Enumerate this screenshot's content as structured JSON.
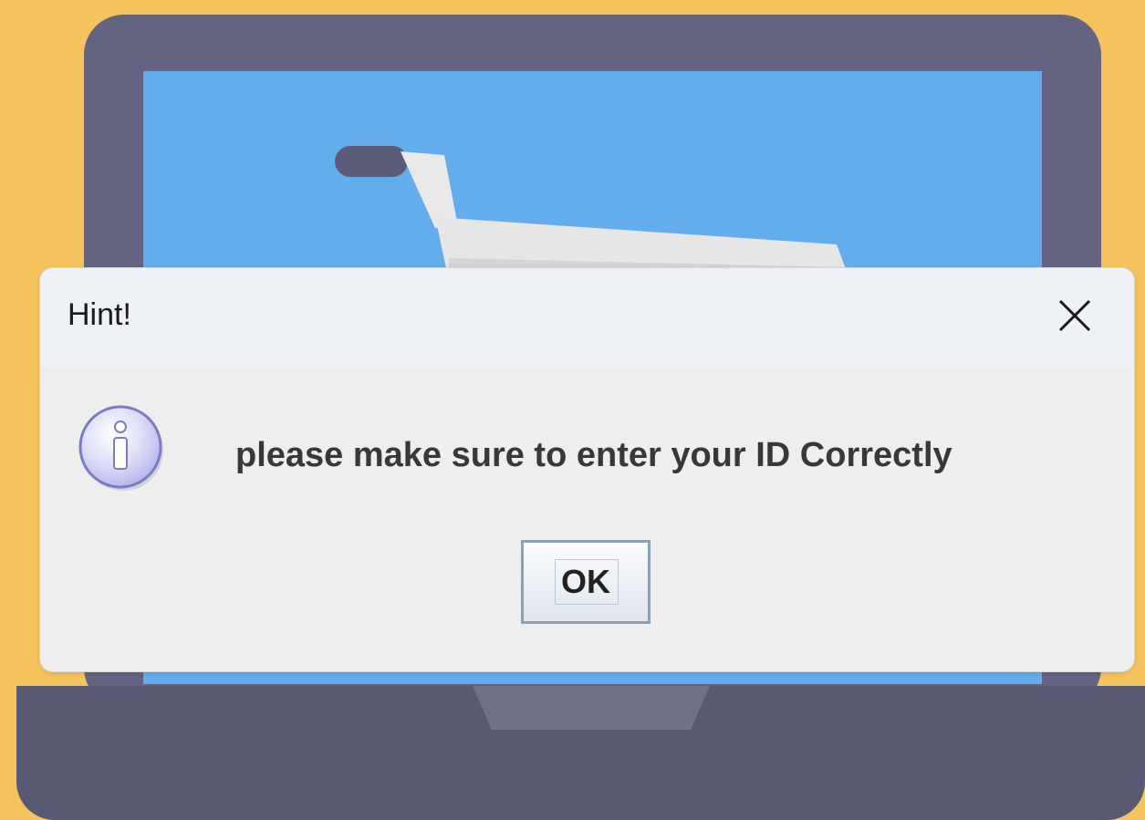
{
  "dialog": {
    "title": "Hint!",
    "message": "please make sure to enter your ID Correctly",
    "ok_label": "OK",
    "icon": "info-icon",
    "close_icon": "close-icon"
  },
  "background": {
    "illustration": "laptop-with-shopping-cart",
    "colors": {
      "page": "#f5c35b",
      "laptop_body": "#626481",
      "screen": "#63aded",
      "cart": "#e6e6e6"
    }
  }
}
